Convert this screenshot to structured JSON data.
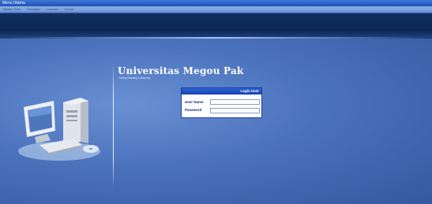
{
  "window": {
    "title": "Menu Utama"
  },
  "menu": {
    "items": [
      "Master Data",
      "Transaksi",
      "Laporan",
      "Keluar"
    ]
  },
  "university": {
    "name": "Universitas Megou Pak",
    "subtitle": "Tulang Bawang Lampung"
  },
  "login": {
    "header": "Login User",
    "username_label": "User Name",
    "password_label": "Password",
    "username_value": "",
    "password_value": ""
  },
  "colors": {
    "background": "#3a5fa8",
    "banner": "#0e2f63",
    "login_header": "#2c64d6",
    "label": "#0b2a88"
  },
  "icons": [
    "computer-illustration-icon"
  ]
}
